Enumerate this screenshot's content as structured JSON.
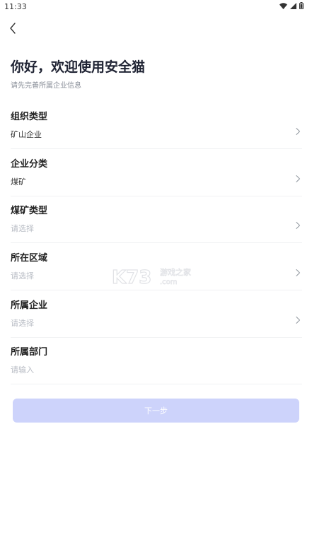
{
  "status_bar": {
    "time": "11:33"
  },
  "header": {
    "title": "你好，欢迎使用安全猫",
    "subtitle": "请先完善所属企业信息"
  },
  "fields": [
    {
      "label": "组织类型",
      "value": "矿山企业",
      "placeholder": false,
      "has_chevron": true
    },
    {
      "label": "企业分类",
      "value": "煤矿",
      "placeholder": false,
      "has_chevron": true
    },
    {
      "label": "煤矿类型",
      "value": "请选择",
      "placeholder": true,
      "has_chevron": true
    },
    {
      "label": "所在区域",
      "value": "请选择",
      "placeholder": true,
      "has_chevron": true
    },
    {
      "label": "所属企业",
      "value": "请选择",
      "placeholder": true,
      "has_chevron": true
    },
    {
      "label": "所属部门",
      "value": "请输入",
      "placeholder": true,
      "has_chevron": false
    }
  ],
  "next_button": {
    "label": "下一步"
  },
  "watermark": {
    "text": "K73",
    "tagline": "游戏之家",
    "domain": ".com"
  },
  "colors": {
    "primary_disabled": "#cdd3fb",
    "placeholder": "#b8bcc4",
    "title": "#1f2333"
  },
  "icons": {
    "back": "chevron-left-icon",
    "chevron": "chevron-right-icon",
    "wifi": "wifi-icon",
    "signal": "signal-icon",
    "battery": "battery-icon"
  }
}
